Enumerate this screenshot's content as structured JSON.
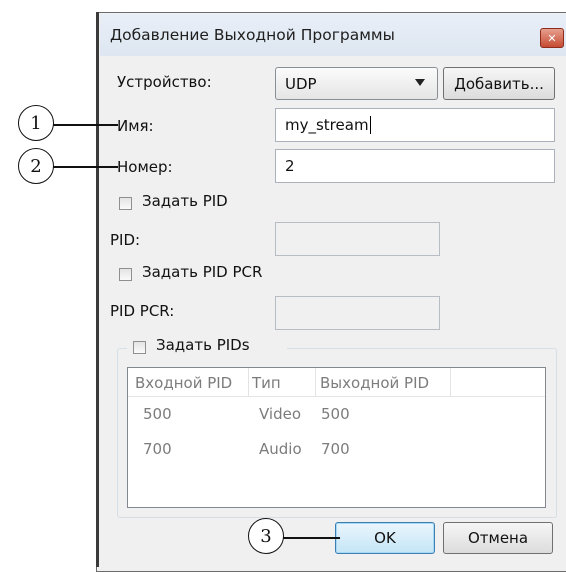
{
  "dialog": {
    "title": "Добавление Выходной Программы",
    "close_glyph": "✕"
  },
  "form": {
    "device_label": "Устройство:",
    "device_value": "UDP",
    "add_button": "Добавить...",
    "name_label": "Имя:",
    "name_value": "my_stream",
    "number_label": "Номер:",
    "number_value": "2",
    "set_pid_label": "Задать PID",
    "pid_label": "PID:",
    "pid_value": "",
    "set_pid_pcr_label": "Задать PID PCR",
    "pid_pcr_label": "PID PCR:",
    "pid_pcr_value": "",
    "set_pids_label": "Задать PIDs"
  },
  "pids_table": {
    "columns": [
      "Входной PID",
      "Тип",
      "Выходной PID"
    ],
    "rows": [
      [
        "500",
        "Video",
        "500"
      ],
      [
        "700",
        "Audio",
        "700"
      ]
    ]
  },
  "footer": {
    "ok_label": "OK",
    "cancel_label": "Отмена"
  },
  "callouts": [
    "1",
    "2",
    "3"
  ],
  "colors": {
    "close_button": "#c64b32",
    "default_button_border": "#3c7fb1"
  }
}
